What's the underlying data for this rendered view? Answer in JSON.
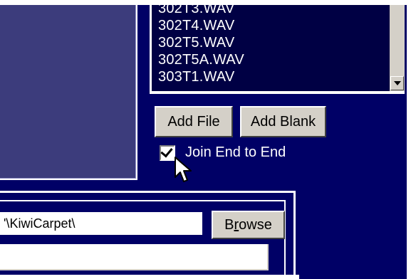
{
  "file_list": {
    "items": [
      "302T3.WAV",
      "302T4.WAV",
      "302T5.WAV",
      "302T5A.WAV",
      "303T1.WAV"
    ]
  },
  "buttons": {
    "add_file": "Add  File",
    "add_blank": "Add Blank",
    "browse_pre": "B",
    "browse_accel": "r",
    "browse_post": "owse"
  },
  "join": {
    "label": "Join End to End",
    "checked": true
  },
  "output": {
    "path": "'\\KiwiCarpet\\",
    "second_value": ""
  }
}
